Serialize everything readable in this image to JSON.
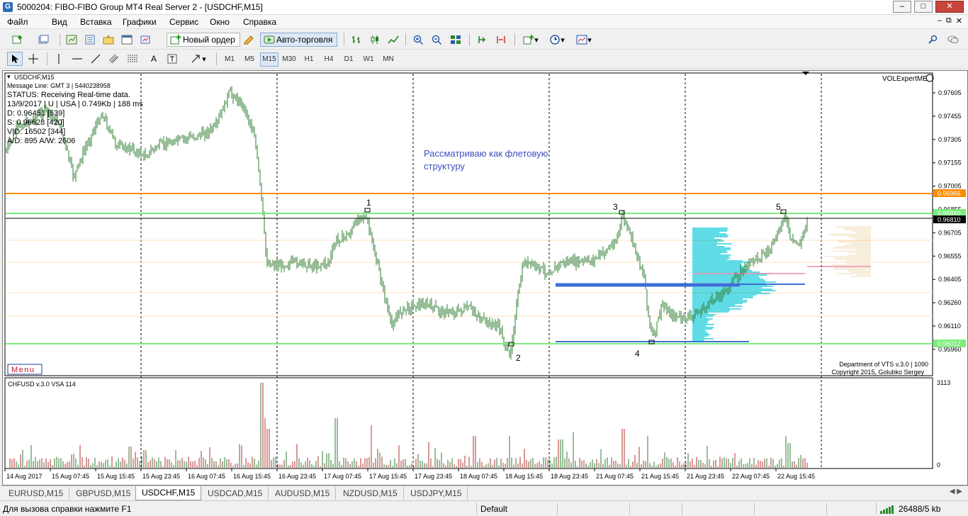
{
  "window": {
    "title": "5000204: FIBO-FIBO Group MT4 Real Server 2 - [USDCHF,M15]"
  },
  "menu": [
    "Файл",
    "Вид",
    "Вставка",
    "Графики",
    "Сервис",
    "Окно",
    "Справка"
  ],
  "toolbar": {
    "new_order_label": "Новый ордер",
    "autotrading_label": "Авто-торговля",
    "timeframes": [
      "M1",
      "M5",
      "M15",
      "M30",
      "H1",
      "H4",
      "D1",
      "W1",
      "MN"
    ],
    "selected_timeframe": "M15"
  },
  "chart": {
    "symbol_label": "USDCHF,M15",
    "info_lines": [
      "Message Line: GMT 3 | 5440238958",
      "STATUS:  Receiving Real-time data.",
      "13/9/2017 | U | USA | 0.749Kb | 188 ms",
      "D: 0.96451  [639]",
      "S: 0.96628  [420]",
      "V|D: 16502  [344]",
      "A/D: 895  A/W: 2606"
    ],
    "expert_label": "VOLExpertME",
    "annotation": [
      "Рассматриваю как флетовую",
      "структуру"
    ],
    "menu_button": "Menu",
    "credits": [
      "Department of VTS  v.3.0 | 1090",
      "Copyright 2015, Golubko Sergey"
    ],
    "point_labels": [
      "1",
      "2",
      "3",
      "4",
      "5"
    ],
    "price_ticks": [
      "0.97605",
      "0.97455",
      "0.97305",
      "0.97155",
      "0.97005",
      "0.96855",
      "0.96705",
      "0.96555",
      "0.96405",
      "0.96260",
      "0.96110",
      "0.95960"
    ],
    "level_labels": [
      "0.96966",
      "0.96840",
      "0.96810",
      "0.96012"
    ],
    "colors": {
      "orange_level": "#ff8c00",
      "green_level": "#7cec7c",
      "price_line": "#000000",
      "volume_profile": "#00c8d8",
      "blue_zone": "#3a6fd8",
      "candles": "#2e7d32"
    }
  },
  "volume_pane": {
    "label": "CHFUSD  v.3.0  VSA  114",
    "max_label": "3113",
    "zero_label": "0"
  },
  "time_axis": [
    "14 Aug 2017",
    "15 Aug 07:45",
    "15 Aug 15:45",
    "15 Aug 23:45",
    "16 Aug 07:45",
    "16 Aug 15:45",
    "16 Aug 23:45",
    "17 Aug 07:45",
    "17 Aug 15:45",
    "17 Aug 23:45",
    "18 Aug 07:45",
    "18 Aug 15:45",
    "18 Aug 23:45",
    "21 Aug 07:45",
    "21 Aug 15:45",
    "21 Aug 23:45",
    "22 Aug 07:45",
    "22 Aug 15:45"
  ],
  "tabs": [
    "EURUSD,M15",
    "GBPUSD,M15",
    "USDCHF,M15",
    "USDCAD,M15",
    "AUDUSD,M15",
    "NZDUSD,M15",
    "USDJPY,M15"
  ],
  "selected_tab": "USDCHF,M15",
  "status": {
    "help": "Для вызова справки нажмите F1",
    "profile": "Default",
    "traffic": "26488/5 kb"
  }
}
